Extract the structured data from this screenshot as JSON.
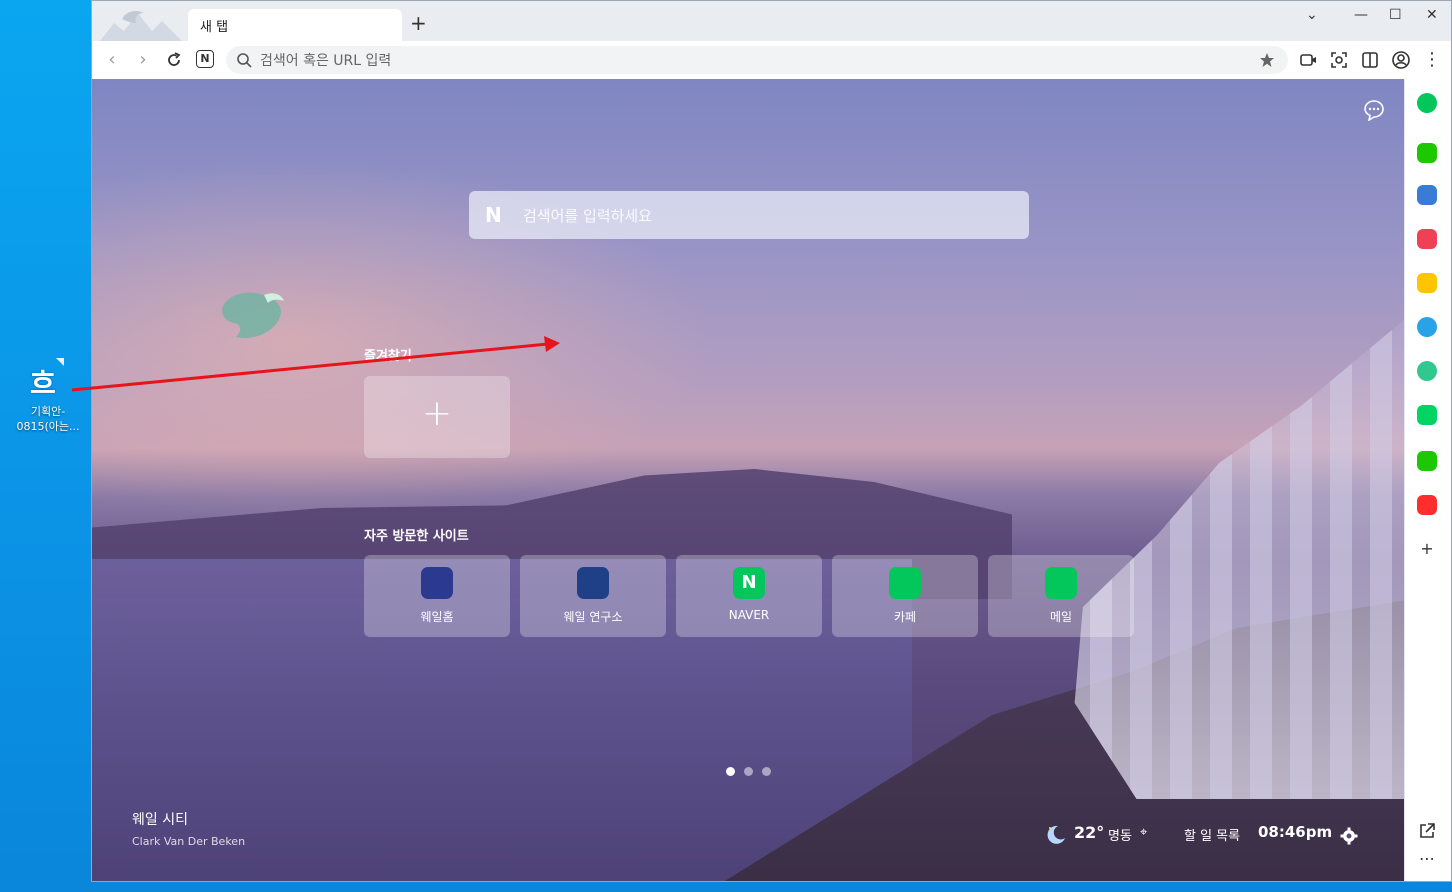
{
  "desktop": {
    "icon_glyph": "흐",
    "icon_label_line1": "기획안-",
    "icon_label_line2": "0815(아는..."
  },
  "browser": {
    "tab_title": "새 탭",
    "new_tab_symbol": "+",
    "window_controls": [
      "⌄",
      "—",
      "☐",
      "✕"
    ],
    "url_placeholder": "검색어 혹은 URL 입력"
  },
  "newtab": {
    "search_placeholder": "검색어를 입력하세요",
    "favorites_title": "즐겨찾기",
    "add_symbol": "+",
    "frequent_title": "자주 방문한 사이트",
    "sites": [
      {
        "label": "웨일홈",
        "color": "#2b3a8f"
      },
      {
        "label": "웨일 연구소",
        "color": "#1f3f86"
      },
      {
        "label": "NAVER",
        "color": "#03c75a"
      },
      {
        "label": "카페",
        "color": "#03c75a"
      },
      {
        "label": "메일",
        "color": "#03c75a"
      }
    ],
    "pager_active": 1,
    "pager_count": 3,
    "credit_title": "웨일 시티",
    "credit_author": "Clark Van Der Beken",
    "weather_temp": "22°",
    "weather_location": "명동",
    "todo_label": "할 일 목록",
    "clock": "08:46pm"
  },
  "sidebar": {
    "more_symbol": "⋯",
    "add_symbol": "+"
  },
  "colors": {
    "accent_green": "#03c75a",
    "annotation_arrow": "#e8141b"
  }
}
